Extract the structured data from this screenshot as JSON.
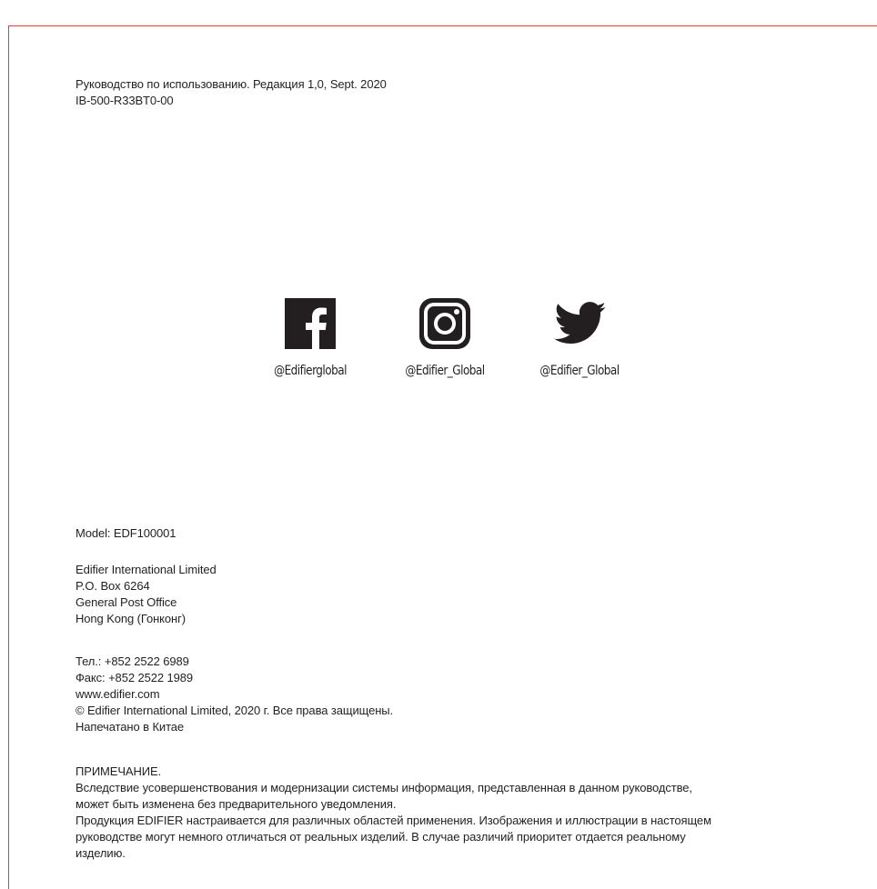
{
  "header": {
    "manual_line": "Руководство по использованию. Редакция 1,0, Sept. 2020",
    "doc_code": "IB-500-R33BT0-00"
  },
  "social": [
    {
      "icon": "facebook-icon",
      "handle": "@Edifierglobal"
    },
    {
      "icon": "instagram-icon",
      "handle": "@Edifier_Global"
    },
    {
      "icon": "twitter-icon",
      "handle": "@Edifier_Global"
    }
  ],
  "model": "Model: EDF100001",
  "address": [
    "Edifier International Limited",
    "P.O. Box 6264",
    "General Post Office",
    "Hong Kong (Гонконг)"
  ],
  "contacts": [
    "Тел.:  +852 2522 6989",
    "Факс:  +852 2522 1989",
    "www.edifier.com",
    "© Edifier International Limited, 2020 г. Все права защищены.",
    "Напечатано в Китае"
  ],
  "note": {
    "title": "ПРИМЕЧАНИЕ.",
    "lines": [
      "Вследствие усовершенствования и модернизации системы информация, представленная в данном руководстве,",
      "может быть изменена без предварительного уведомления.",
      "Продукция EDIFIER настраивается для различных областей применения. Изображения и иллюстрации в настоящем",
      "руководстве могут немного отличаться от реальных изделий. В случае различий приоритет отдается реальному",
      "изделию."
    ]
  },
  "colors": {
    "frame": "#e5383b",
    "text": "#231f20"
  }
}
